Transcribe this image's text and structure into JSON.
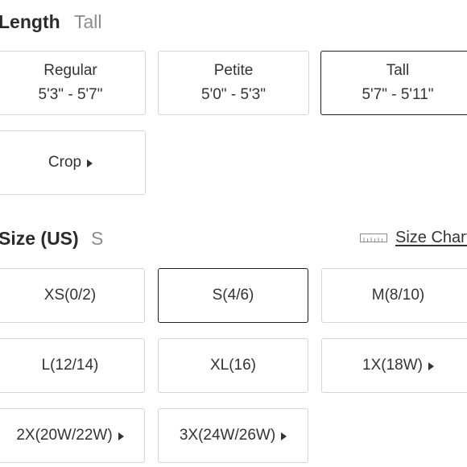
{
  "length": {
    "title": "Length",
    "selected_value": "Tall",
    "options": [
      {
        "label": "Regular",
        "range": "5'3\" - 5'7\""
      },
      {
        "label": "Petite",
        "range": "5'0\" - 5'3\""
      },
      {
        "label": "Tall",
        "range": "5'7\" - 5'11\""
      },
      {
        "label": "Crop"
      }
    ]
  },
  "size": {
    "title": "Size (US)",
    "selected_value": "S",
    "size_chart_label": "Size Chart",
    "ruler_icon": "ruler-icon",
    "options": [
      {
        "label": "XS(0/2)"
      },
      {
        "label": "S(4/6)"
      },
      {
        "label": "M(8/10)"
      },
      {
        "label": "L(12/14)"
      },
      {
        "label": "XL(16)"
      },
      {
        "label": "1X(18W)"
      },
      {
        "label": "2X(20W/22W)"
      },
      {
        "label": "3X(24W/26W)"
      }
    ]
  },
  "colors": {
    "selected_border": "#1f1f1f",
    "border": "#d6d6d6",
    "muted_text": "#8c8c8c"
  }
}
